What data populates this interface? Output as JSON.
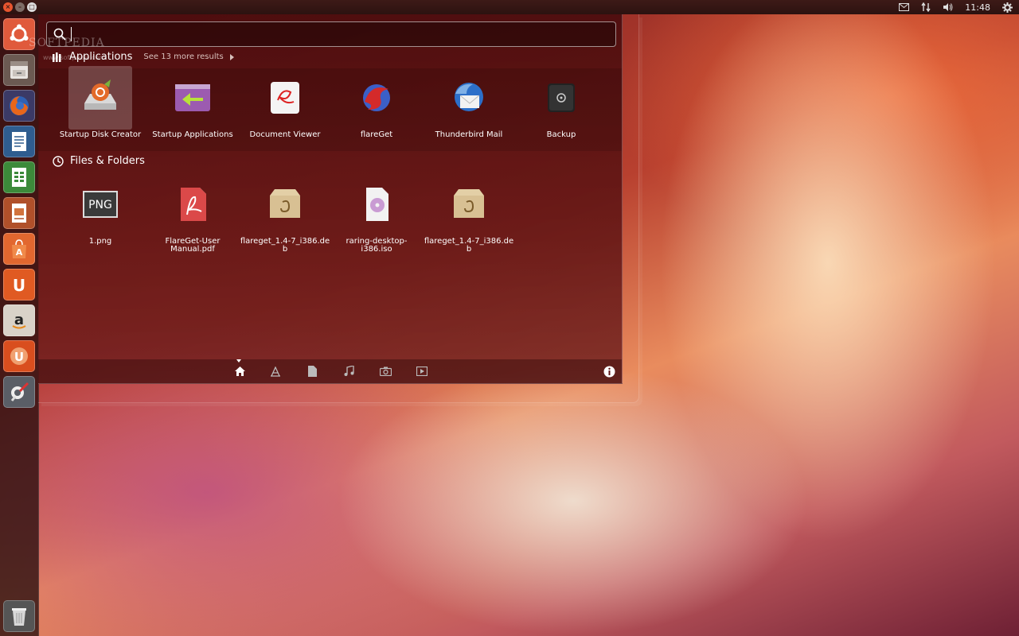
{
  "window_controls": {
    "close": "×",
    "minimize": "–",
    "maximize": "□"
  },
  "indicators": {
    "mail_icon": "mail-icon",
    "network_icon": "network-icon",
    "volume_icon": "volume-icon",
    "clock": "11:48",
    "session_icon": "gear-icon"
  },
  "launcher": {
    "items": [
      {
        "name": "dash-home",
        "icon": "ubuntu-logo-icon"
      },
      {
        "name": "files",
        "icon": "file-cabinet-icon"
      },
      {
        "name": "firefox",
        "icon": "firefox-icon"
      },
      {
        "name": "writer",
        "icon": "writer-icon"
      },
      {
        "name": "calc",
        "icon": "calc-icon"
      },
      {
        "name": "impress",
        "icon": "impress-icon"
      },
      {
        "name": "software-center",
        "icon": "shopping-bag-icon"
      },
      {
        "name": "ubuntu-one",
        "icon": "ubuntu-one-icon"
      },
      {
        "name": "amazon",
        "icon": "amazon-icon"
      },
      {
        "name": "ubuntu-one-music",
        "icon": "ubuntu-one-music-icon"
      },
      {
        "name": "system-settings",
        "icon": "settings-icon"
      },
      {
        "name": "trash",
        "icon": "trash-icon"
      }
    ]
  },
  "search": {
    "value": "",
    "placeholder": ""
  },
  "watermark": {
    "text": "SOFTPEDIA",
    "sub": "www.softpedia.com"
  },
  "applications": {
    "title": "Applications",
    "more": "See 13 more results",
    "items": [
      {
        "label": "Startup Disk Creator"
      },
      {
        "label": "Startup Applications"
      },
      {
        "label": "Document Viewer"
      },
      {
        "label": "flareGet"
      },
      {
        "label": "Thunderbird Mail"
      },
      {
        "label": "Backup"
      }
    ]
  },
  "files": {
    "title": "Files & Folders",
    "items": [
      {
        "label": "1.png",
        "badge": "PNG"
      },
      {
        "label": "FlareGet-User Manual.pdf"
      },
      {
        "label": "flareget_1.4-7_i386.de b"
      },
      {
        "label": "raring-desktop-i386.iso"
      },
      {
        "label": "flareget_1.4-7_i386.de b"
      }
    ]
  },
  "colors": {
    "accent": "#e9552f",
    "dash_bg": "#5a1214",
    "highlight": "#ffffff"
  }
}
